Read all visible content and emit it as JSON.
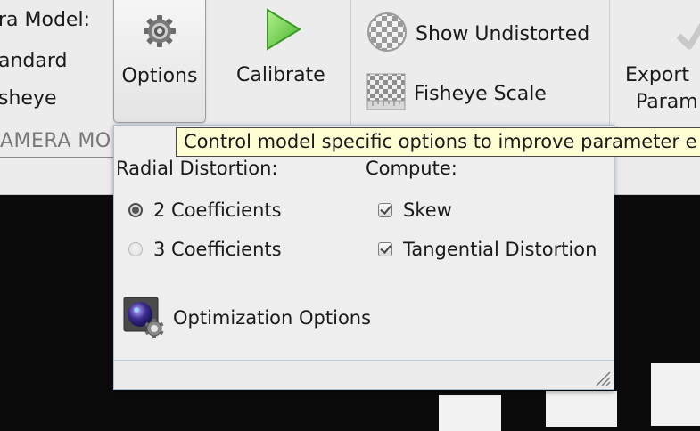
{
  "toolstrip": {
    "camera_model_label": "ra Model:",
    "radio_standard": "andard",
    "radio_fisheye": "sheye",
    "section_label": "AMERA MO",
    "options_label": "Options",
    "calibrate_label": "Calibrate",
    "show_undistorted_label": "Show Undistorted",
    "fisheye_scale_label": "Fisheye Scale",
    "export_label_line1": "Export",
    "export_label_line2": "Param"
  },
  "tooltip": {
    "text": "Control model specific options to improve parameter e"
  },
  "popup": {
    "radial_title": "Radial Distortion:",
    "radial_options": [
      "2 Coefficients",
      "3 Coefficients"
    ],
    "radial_selected": "2 Coefficients",
    "compute_title": "Compute:",
    "compute_options": [
      {
        "label": "Skew",
        "checked": true
      },
      {
        "label": "Tangential Distortion",
        "checked": true
      }
    ],
    "optimization_label": "Optimization Options"
  },
  "icons": {
    "options": "gear-icon",
    "calibrate": "play-icon",
    "show_undistorted": "checker-sphere-icon",
    "fisheye_scale": "checker-ruler-icon",
    "export": "check-icon",
    "optimization": "camera-gear-icon",
    "resize": "resize-grip-icon"
  },
  "colors": {
    "calibrate_green": "#5cc43a",
    "tooltip_bg": "#fefed2",
    "popup_border": "#a9bfd6"
  }
}
